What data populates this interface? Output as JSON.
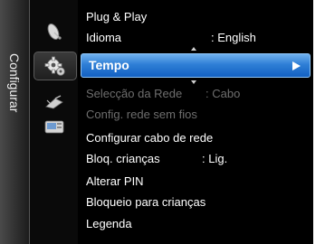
{
  "sidebar": {
    "label": "Configurar"
  },
  "icons": [
    {
      "name": "satellite-dish-icon"
    },
    {
      "name": "settings-gear-icon"
    },
    {
      "name": "input-antenna-icon"
    },
    {
      "name": "application-icon"
    }
  ],
  "menu": {
    "plug_play": "Plug & Play",
    "idioma": {
      "label": "Idioma",
      "value": ": English"
    },
    "tempo": "Tempo",
    "seleccao_rede": {
      "label": "Selecção da Rede",
      "value": ": Cabo"
    },
    "config_rede_sem_fios": "Config. rede sem fios",
    "configurar_cabo": "Configurar cabo de rede",
    "bloq_criancas": {
      "label": "Bloq. crianças",
      "value": ": Lig."
    },
    "alterar_pin": "Alterar PIN",
    "bloqueio_criancas": "Bloqueio para crianças",
    "legenda": "Legenda"
  },
  "colors": {
    "selection": "#2f7fd6",
    "text": "#ffffff",
    "disabled": "#6e6e6e"
  }
}
